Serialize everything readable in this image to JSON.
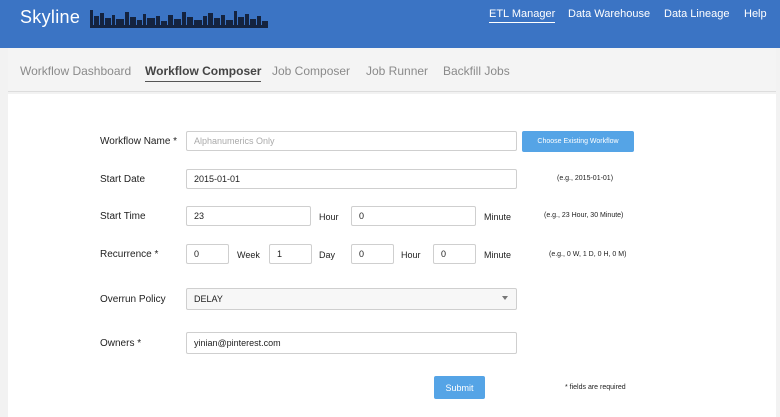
{
  "app": {
    "brand": "Skyline",
    "top_nav": [
      {
        "label": "ETL Manager",
        "active": true
      },
      {
        "label": "Data Warehouse",
        "active": false
      },
      {
        "label": "Data Lineage",
        "active": false
      },
      {
        "label": "Help",
        "active": false
      }
    ],
    "accent_color": "#3b74c4"
  },
  "tabs": [
    {
      "label": "Workflow Dashboard",
      "active": false
    },
    {
      "label": "Workflow Composer",
      "active": true
    },
    {
      "label": "Job Composer",
      "active": false
    },
    {
      "label": "Job Runner",
      "active": false
    },
    {
      "label": "Backfill Jobs",
      "active": false
    }
  ],
  "form": {
    "workflow_name": {
      "label": "Workflow Name *",
      "value": "",
      "placeholder": "Alphanumerics Only",
      "button": "Choose Existing Workflow"
    },
    "start_date": {
      "label": "Start Date",
      "value": "2015-01-01",
      "hint": "(e.g., 2015-01-01)"
    },
    "start_time": {
      "label": "Start Time",
      "hour_value": "23",
      "hour_unit": "Hour",
      "minute_value": "0",
      "minute_unit": "Minute",
      "hint": "(e.g., 23 Hour, 30 Minute)"
    },
    "recurrence": {
      "label": "Recurrence *",
      "week_value": "0",
      "week_unit": "Week",
      "day_value": "1",
      "day_unit": "Day",
      "hour_value": "0",
      "hour_unit": "Hour",
      "minute_value": "0",
      "minute_unit": "Minute",
      "hint": "(e.g., 0 W, 1 D, 0 H, 0 M)"
    },
    "overrun_policy": {
      "label": "Overrun Policy",
      "selected": "DELAY"
    },
    "owners": {
      "label": "Owners *",
      "value": "yinian@pinterest.com"
    },
    "submit_label": "Submit",
    "required_note": "* fields are required"
  }
}
